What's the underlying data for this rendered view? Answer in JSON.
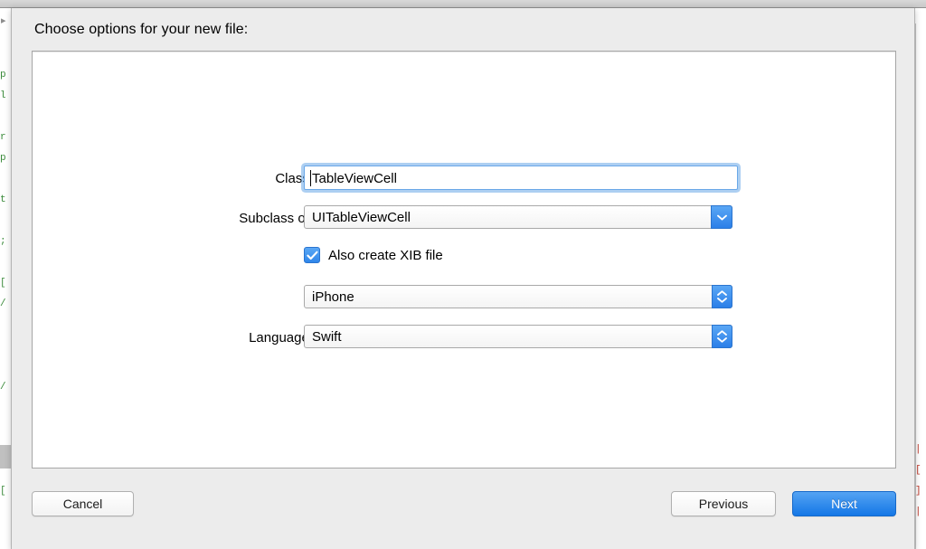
{
  "window": {
    "sheet_title": "Choose options for your new file:"
  },
  "form": {
    "rows": [
      {
        "label": "Class:",
        "control": "text-field",
        "value": "TableViewCell",
        "placeholder": "",
        "focused": true
      },
      {
        "label": "Subclass of:",
        "control": "combo-box",
        "value": "UITableViewCell",
        "icon": "chevron-down-icon"
      },
      {
        "label": "",
        "control": "checkbox",
        "value": "Also create XIB file",
        "checked": true,
        "icon": "checkmark-icon"
      },
      {
        "label": "",
        "control": "popup-button",
        "value": "iPhone",
        "icon": "chevron-up-down-icon"
      },
      {
        "label": "Language:",
        "control": "popup-button",
        "value": "Swift",
        "icon": "chevron-up-down-icon"
      }
    ]
  },
  "buttons": {
    "cancel": "Cancel",
    "previous": "Previous",
    "next": "Next"
  },
  "colors": {
    "accent_blue": "#2b7fe8",
    "sheet_background": "#ececec",
    "panel_background": "#ffffff",
    "focus_ring": "#6aa8e8",
    "text": "#000000"
  },
  "backdrop": {
    "left_code_fragments": [
      "",
      "",
      "p",
      "l",
      "",
      "r",
      "p",
      "",
      "t",
      "",
      ";",
      "",
      "[",
      "/",
      "",
      "",
      "",
      "/",
      "",
      "",
      "",
      "",
      "[",
      ""
    ],
    "right_code_fragments": [
      "",
      "",
      "",
      "",
      "",
      "",
      "",
      "",
      "",
      "",
      "",
      "",
      "",
      "",
      "",
      "",
      "",
      "",
      "",
      "",
      "|",
      "[",
      "]",
      "|"
    ]
  }
}
